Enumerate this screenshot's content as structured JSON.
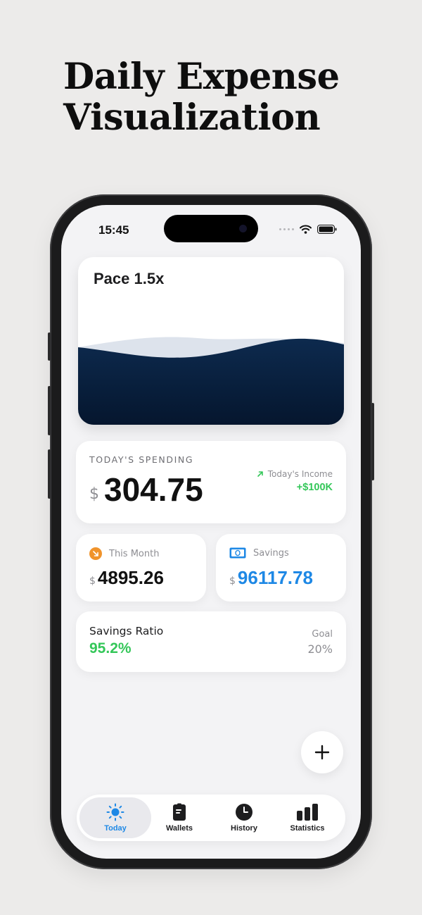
{
  "headline": {
    "line1": "Daily Expense",
    "line2": "Visualization"
  },
  "status_bar": {
    "time": "15:45"
  },
  "pace_card": {
    "title": "Pace 1.5x",
    "wave_color": "#0b2545"
  },
  "spending_card": {
    "label": "TODAY'S SPENDING",
    "currency": "$",
    "amount": "304.75",
    "income_label": "Today's Income",
    "income_value": "+$100K"
  },
  "month_card": {
    "label": "This Month",
    "currency": "$",
    "amount": "4895.26",
    "icon": "arrow-down-right-circle-icon"
  },
  "savings_card": {
    "label": "Savings",
    "currency": "$",
    "amount": "96117.78",
    "icon": "banknote-icon"
  },
  "ratio_card": {
    "label": "Savings Ratio",
    "value": "95.2%",
    "goal_label": "Goal",
    "goal_value": "20%"
  },
  "tabs": [
    {
      "label": "Today",
      "icon": "sun-icon",
      "active": true
    },
    {
      "label": "Wallets",
      "icon": "wallet-icon",
      "active": false
    },
    {
      "label": "History",
      "icon": "clock-icon",
      "active": false
    },
    {
      "label": "Statistics",
      "icon": "bar-chart-icon",
      "active": false
    }
  ],
  "colors": {
    "accent_blue": "#1e88e5",
    "positive_green": "#34c759",
    "orange": "#f0932b",
    "navy": "#0b2545"
  }
}
